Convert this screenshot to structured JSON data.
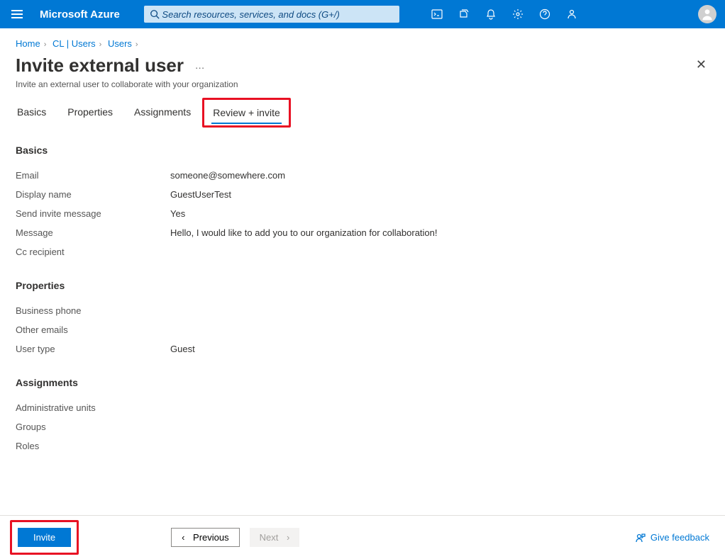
{
  "header": {
    "brand": "Microsoft Azure",
    "search_placeholder": "Search resources, services, and docs (G+/)"
  },
  "breadcrumbs": {
    "items": [
      "Home",
      "CL | Users",
      "Users"
    ]
  },
  "page": {
    "title": "Invite external user",
    "subtitle": "Invite an external user to collaborate with your organization"
  },
  "tabs": {
    "items": [
      "Basics",
      "Properties",
      "Assignments",
      "Review + invite"
    ],
    "active_index": 3
  },
  "sections": {
    "basics": {
      "heading": "Basics",
      "fields": {
        "email_label": "Email",
        "email_value": "someone@somewhere.com",
        "display_name_label": "Display name",
        "display_name_value": "GuestUserTest",
        "send_invite_label": "Send invite message",
        "send_invite_value": "Yes",
        "message_label": "Message",
        "message_value": "Hello, I would like to add you to our organization for collaboration!",
        "cc_label": "Cc recipient",
        "cc_value": ""
      }
    },
    "properties": {
      "heading": "Properties",
      "fields": {
        "business_phone_label": "Business phone",
        "business_phone_value": "",
        "other_emails_label": "Other emails",
        "other_emails_value": "",
        "user_type_label": "User type",
        "user_type_value": "Guest"
      }
    },
    "assignments": {
      "heading": "Assignments",
      "fields": {
        "admin_units_label": "Administrative units",
        "admin_units_value": "",
        "groups_label": "Groups",
        "groups_value": "",
        "roles_label": "Roles",
        "roles_value": ""
      }
    }
  },
  "footer": {
    "invite": "Invite",
    "previous": "Previous",
    "next": "Next",
    "feedback": "Give feedback"
  }
}
